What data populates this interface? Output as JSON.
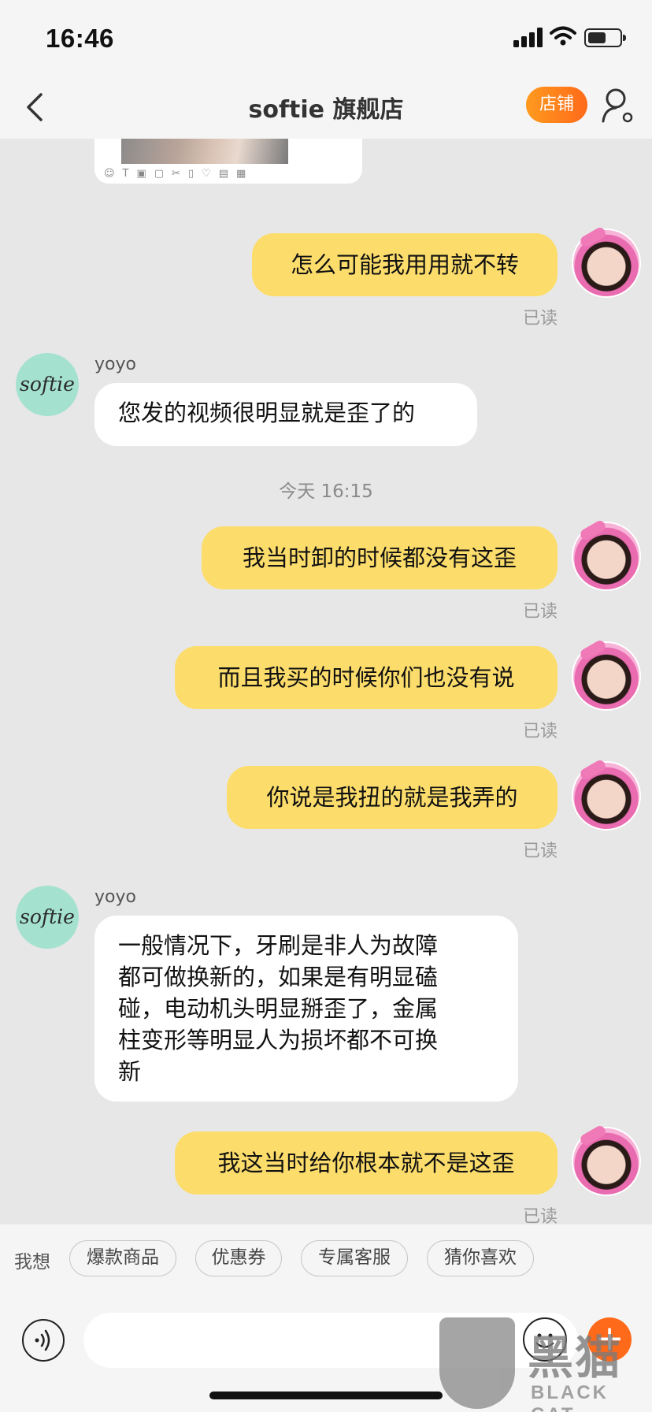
{
  "status_bar": {
    "time": "16:46"
  },
  "nav": {
    "title": "softie 旗舰店",
    "store_button": "店铺"
  },
  "messages": [
    {
      "side": "me",
      "text": "怎么可能我用用就不转",
      "read": "已读"
    },
    {
      "side": "them",
      "sender": "yoyo",
      "avatar_text": "softie",
      "text": "您发的视频很明显就是歪了的"
    },
    {
      "timestamp": "今天 16:15"
    },
    {
      "side": "me",
      "text": "我当时卸的时候都没有这歪",
      "read": "已读"
    },
    {
      "side": "me",
      "text": "而且我买的时候你们也没有说",
      "read": "已读"
    },
    {
      "side": "me",
      "text": "你说是我扭的就是我弄的",
      "read": "已读"
    },
    {
      "side": "them",
      "sender": "yoyo",
      "avatar_text": "softie",
      "lines": [
        "一般情况下，牙刷是非人为故障",
        "都可做换新的，如果是有明显磕",
        "碰，电动机头明显掰歪了，金属",
        "柱变形等明显人为损坏都不可换",
        "新"
      ]
    },
    {
      "side": "me",
      "text": "我这当时给你根本就不是这歪",
      "read": "已读"
    }
  ],
  "quick_replies": {
    "label": "我想",
    "chips": [
      "爆款商品",
      "优惠券",
      "专属客服",
      "猜你喜欢"
    ]
  },
  "input": {
    "placeholder": ""
  },
  "watermark": {
    "main": "黑猫",
    "sub": "BLACK CAT"
  },
  "colors": {
    "my_bubble": "#fcdd6c",
    "their_bubble": "#ffffff",
    "accent": "#ff6a1a",
    "background": "#e7e7e7"
  },
  "icons": [
    "back-icon",
    "user-settings-icon",
    "voice-icon",
    "emoji-icon",
    "plus-icon"
  ]
}
